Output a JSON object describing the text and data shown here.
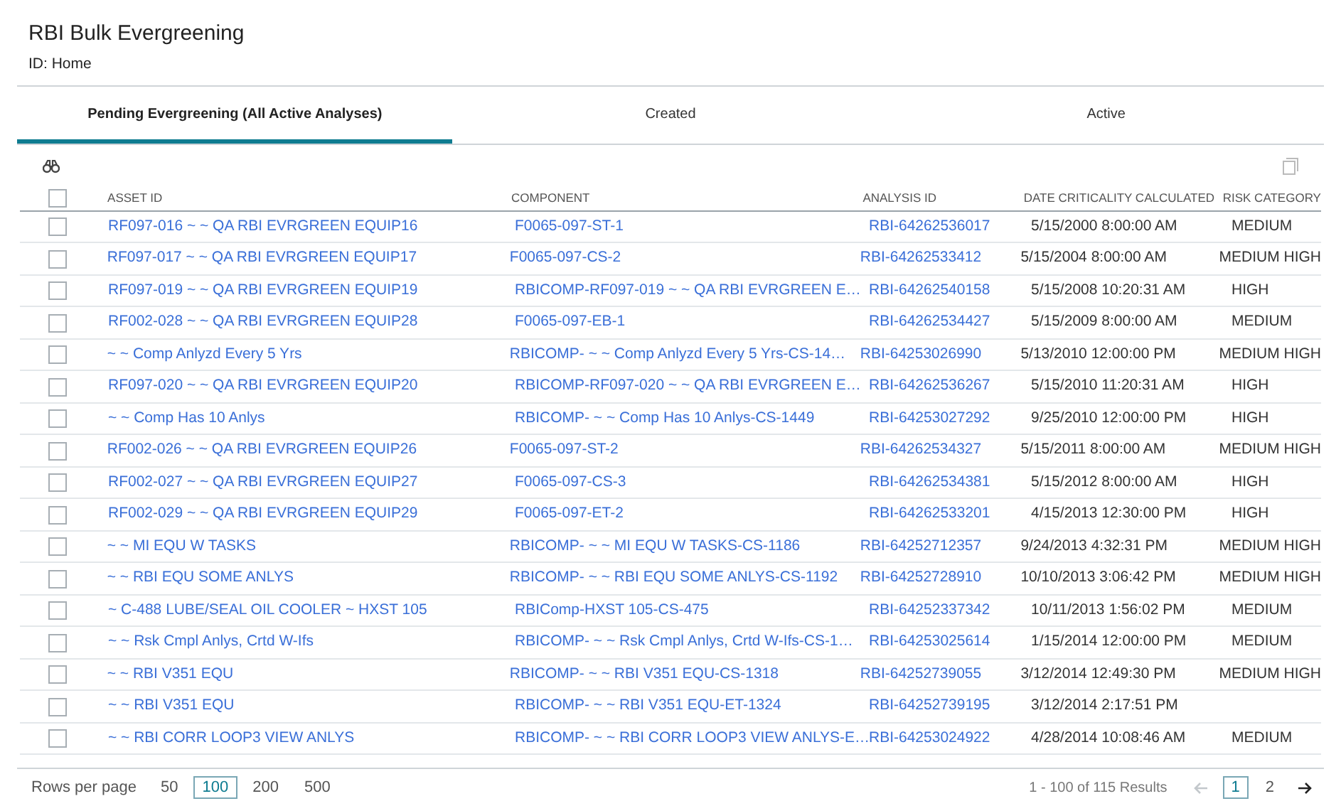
{
  "header": {
    "title": "RBI Bulk Evergreening",
    "subtitle": "ID: Home"
  },
  "tabs": [
    {
      "label": "Pending Evergreening (All Active Analyses)",
      "selected": true
    },
    {
      "label": "Created",
      "selected": false
    },
    {
      "label": "Active",
      "selected": false
    }
  ],
  "table": {
    "select_all": {
      "checked": false
    },
    "columns": [
      "ASSET ID",
      "COMPONENT",
      "ANALYSIS ID",
      "DATE CRITICALITY CALCULATED",
      "RISK CATEGORY"
    ],
    "rows": [
      {
        "checked": false,
        "asset_id": "RF097-016 ~ ~ QA RBI EVRGREEN EQUIP16",
        "component": "F0065-097-ST-1",
        "analysis_id": "RBI-64262536017",
        "date": "5/15/2000 8:00:00 AM",
        "risk": "MEDIUM"
      },
      {
        "checked": false,
        "asset_id": "RF097-017 ~ ~ QA RBI EVRGREEN EQUIP17",
        "component": "F0065-097-CS-2",
        "analysis_id": "RBI-64262533412",
        "date": "5/15/2004 8:00:00 AM",
        "risk": "MEDIUM HIGH"
      },
      {
        "checked": false,
        "asset_id": "RF097-019 ~ ~ QA RBI EVRGREEN EQUIP19",
        "component": "RBICOMP-RF097-019 ~ ~ QA RBI EVRGREEN E…",
        "analysis_id": "RBI-64262540158",
        "date": "5/15/2008 10:20:31 AM",
        "risk": "HIGH"
      },
      {
        "checked": false,
        "asset_id": "RF002-028 ~ ~ QA RBI EVRGREEN EQUIP28",
        "component": "F0065-097-EB-1",
        "analysis_id": "RBI-64262534427",
        "date": "5/15/2009 8:00:00 AM",
        "risk": "MEDIUM"
      },
      {
        "checked": false,
        "asset_id": "~ ~ Comp Anlyzd Every 5 Yrs",
        "component": "RBICOMP- ~ ~ Comp Anlyzd Every 5 Yrs-CS-14…",
        "analysis_id": "RBI-64253026990",
        "date": "5/13/2010 12:00:00 PM",
        "risk": "MEDIUM HIGH"
      },
      {
        "checked": false,
        "asset_id": "RF097-020 ~ ~ QA RBI EVRGREEN EQUIP20",
        "component": "RBICOMP-RF097-020 ~ ~ QA RBI EVRGREEN E…",
        "analysis_id": "RBI-64262536267",
        "date": "5/15/2010 11:20:31 AM",
        "risk": "HIGH"
      },
      {
        "checked": false,
        "asset_id": "~ ~ Comp Has 10 Anlys",
        "component": "RBICOMP- ~ ~ Comp Has 10 Anlys-CS-1449",
        "analysis_id": "RBI-64253027292",
        "date": "9/25/2010 12:00:00 PM",
        "risk": "HIGH"
      },
      {
        "checked": false,
        "asset_id": "RF002-026 ~ ~ QA RBI EVRGREEN EQUIP26",
        "component": "F0065-097-ST-2",
        "analysis_id": "RBI-64262534327",
        "date": "5/15/2011 8:00:00 AM",
        "risk": "MEDIUM HIGH"
      },
      {
        "checked": false,
        "asset_id": "RF002-027 ~ ~ QA RBI EVRGREEN EQUIP27",
        "component": "F0065-097-CS-3",
        "analysis_id": "RBI-64262534381",
        "date": "5/15/2012 8:00:00 AM",
        "risk": "HIGH"
      },
      {
        "checked": false,
        "asset_id": "RF002-029 ~ ~ QA RBI EVRGREEN EQUIP29",
        "component": "F0065-097-ET-2",
        "analysis_id": "RBI-64262533201",
        "date": "4/15/2013 12:30:00 PM",
        "risk": "HIGH"
      },
      {
        "checked": false,
        "asset_id": "~ ~ MI EQU W TASKS",
        "component": "RBICOMP- ~ ~ MI EQU W TASKS-CS-1186",
        "analysis_id": "RBI-64252712357",
        "date": "9/24/2013 4:32:31 PM",
        "risk": "MEDIUM HIGH"
      },
      {
        "checked": false,
        "asset_id": "~ ~ RBI EQU SOME ANLYS",
        "component": "RBICOMP- ~ ~ RBI EQU SOME ANLYS-CS-1192",
        "analysis_id": "RBI-64252728910",
        "date": "10/10/2013 3:06:42 PM",
        "risk": "MEDIUM HIGH"
      },
      {
        "checked": false,
        "asset_id": "~ C-488 LUBE/SEAL OIL COOLER ~ HXST 105",
        "component": "RBIComp-HXST 105-CS-475",
        "analysis_id": "RBI-64252337342",
        "date": "10/11/2013 1:56:02 PM",
        "risk": "MEDIUM"
      },
      {
        "checked": false,
        "asset_id": "~ ~ Rsk Cmpl Anlys, Crtd W-Ifs",
        "component": "RBICOMP- ~ ~ Rsk Cmpl Anlys, Crtd W-Ifs-CS-1…",
        "analysis_id": "RBI-64253025614",
        "date": "1/15/2014 12:00:00 PM",
        "risk": "MEDIUM"
      },
      {
        "checked": false,
        "asset_id": "~ ~ RBI V351 EQU",
        "component": "RBICOMP- ~ ~ RBI V351 EQU-CS-1318",
        "analysis_id": "RBI-64252739055",
        "date": "3/12/2014 12:49:30 PM",
        "risk": "MEDIUM HIGH"
      },
      {
        "checked": false,
        "asset_id": "~ ~ RBI V351 EQU",
        "component": "RBICOMP- ~ ~ RBI V351 EQU-ET-1324",
        "analysis_id": "RBI-64252739195",
        "date": "3/12/2014 2:17:51 PM"
      },
      {
        "checked": false,
        "asset_id": "~ ~ RBI CORR LOOP3 VIEW ANLYS",
        "component": "RBICOMP- ~ ~ RBI CORR LOOP3 VIEW ANLYS-E…",
        "analysis_id": "RBI-64253024922",
        "date": "4/28/2014 10:08:46 AM",
        "risk": "MEDIUM"
      }
    ]
  },
  "footer": {
    "rows_per_page_label": "Rows per page",
    "rows_per_page": [
      {
        "label": "50",
        "selected": false
      },
      {
        "label": "100",
        "selected": true
      },
      {
        "label": "200",
        "selected": false
      },
      {
        "label": "500",
        "selected": false
      }
    ],
    "results": "1 - 100 of 115 Results",
    "prev": {
      "disabled": true
    },
    "pages": [
      {
        "label": "1",
        "selected": true
      },
      {
        "label": "2",
        "selected": false
      }
    ],
    "next": {
      "disabled": false
    }
  }
}
